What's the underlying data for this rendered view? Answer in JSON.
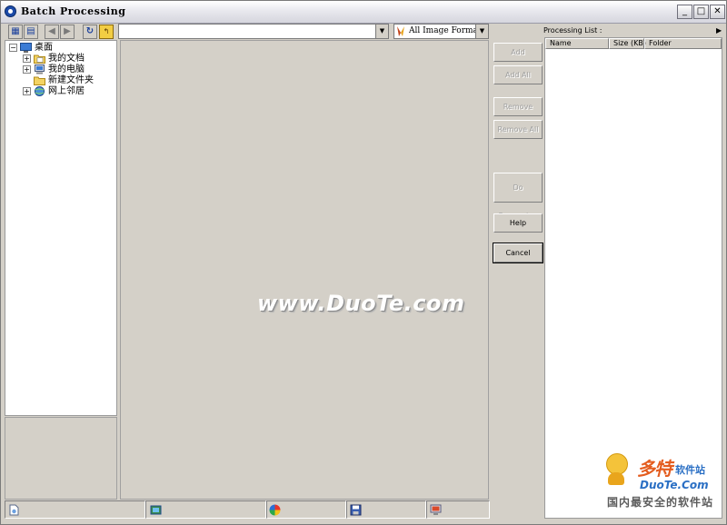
{
  "window": {
    "title": "Batch Processing"
  },
  "toolbar": {
    "path_value": "",
    "filter_label": "All Image Format"
  },
  "tree": {
    "items": [
      {
        "label": "桌面",
        "expander": "−"
      },
      {
        "label": "我的文档",
        "expander": "+"
      },
      {
        "label": "我的电脑",
        "expander": "+"
      },
      {
        "label": "新建文件夹",
        "expander": ""
      },
      {
        "label": "网上邻居",
        "expander": "+"
      }
    ]
  },
  "watermark": "www.DuoTe.com",
  "buttons": {
    "add": "Add",
    "add_all": "Add All",
    "remove": "Remove",
    "remove_all": "Remove All",
    "do_processing": "Do Processing",
    "help": "Help",
    "cancel": "Cancel"
  },
  "processing_list": {
    "label": "Processing List :",
    "columns": [
      "Name",
      "Size (KB)",
      "Folder"
    ],
    "rows": []
  },
  "logo": {
    "brand": "多特",
    "sub": "软件站",
    "url": "DuoTe.Com",
    "tagline": "国内最安全的软件站"
  }
}
